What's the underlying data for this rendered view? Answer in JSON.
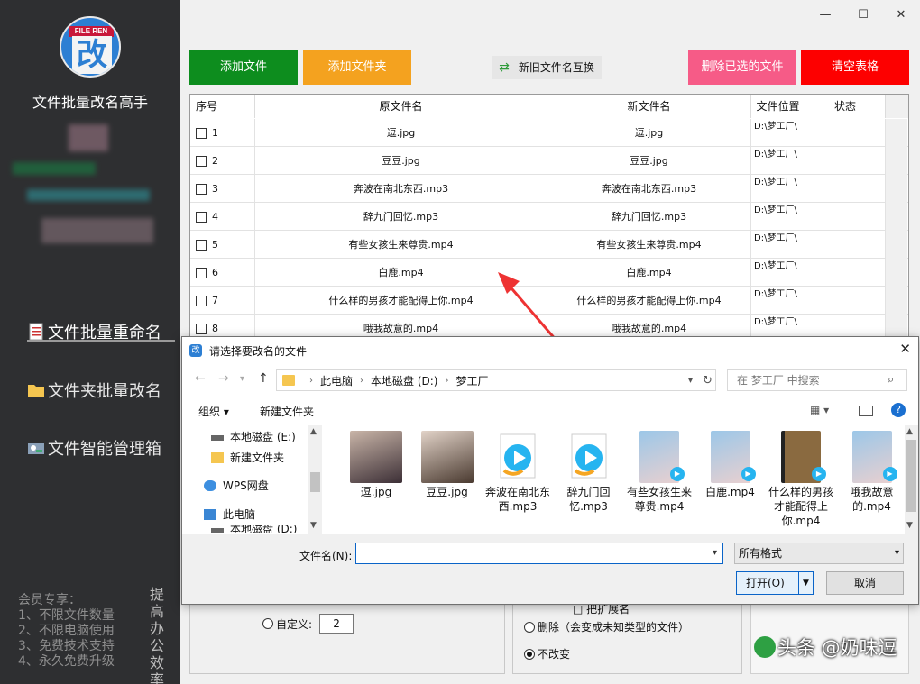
{
  "sidebar": {
    "logo_tag": "FILE REN",
    "logo_glyph": "改",
    "app_title": "文件批量改名高手",
    "nav": [
      "文件批量重命名",
      "文件夹批量改名",
      "文件智能管理箱"
    ],
    "member_lines": [
      "会员专享：",
      "1、不限文件数量",
      "2、不限电脑使用",
      "3、免费技术支持",
      "4、永久免费升级"
    ],
    "vertical_slogan": [
      "提",
      "高",
      "办",
      "公",
      "效",
      "率"
    ]
  },
  "window_controls": {
    "minimize": "—",
    "maximize": "☐",
    "close": "✕"
  },
  "toolbar": {
    "add_file": "添加文件",
    "add_folder": "添加文件夹",
    "swap_names": "新旧文件名互换",
    "delete_selected": "删除已选的文件",
    "clear_table": "清空表格"
  },
  "table": {
    "headers": [
      "序号",
      "原文件名",
      "新文件名",
      "文件位置",
      "状态"
    ],
    "rows": [
      {
        "index": "1",
        "original": "逗.jpg",
        "new": "逗.jpg",
        "location": "D:\\梦工厂\\",
        "status": ""
      },
      {
        "index": "2",
        "original": "豆豆.jpg",
        "new": "豆豆.jpg",
        "location": "D:\\梦工厂\\",
        "status": ""
      },
      {
        "index": "3",
        "original": "奔波在南北东西.mp3",
        "new": "奔波在南北东西.mp3",
        "location": "D:\\梦工厂\\",
        "status": ""
      },
      {
        "index": "4",
        "original": "辞九门回忆.mp3",
        "new": "辞九门回忆.mp3",
        "location": "D:\\梦工厂\\",
        "status": ""
      },
      {
        "index": "5",
        "original": "有些女孩生来尊贵.mp4",
        "new": "有些女孩生来尊贵.mp4",
        "location": "D:\\梦工厂\\",
        "status": ""
      },
      {
        "index": "6",
        "original": "白鹿.mp4",
        "new": "白鹿.mp4",
        "location": "D:\\梦工厂\\",
        "status": ""
      },
      {
        "index": "7",
        "original": "什么样的男孩才能配得上你.mp4",
        "new": "什么样的男孩才能配得上你.mp4",
        "location": "D:\\梦工厂\\",
        "status": ""
      },
      {
        "index": "8",
        "original": "哦我故意的.mp4",
        "new": "哦我故意的.mp4",
        "location": "D:\\梦工厂\\",
        "status": ""
      }
    ]
  },
  "options": {
    "custom_label": "自定义:",
    "custom_value": "2",
    "partial_top_text": "□ 把扩展名",
    "delete_ext_label": "删除（会变成未知类型的文件）",
    "no_change_label": "不改变"
  },
  "watermark": "头条 @奶味逗",
  "dialog": {
    "title": "请选择要改名的文件",
    "close": "✕",
    "breadcrumb": [
      "此电脑",
      "本地磁盘 (D:)",
      "梦工厂"
    ],
    "search_placeholder": "在 梦工厂 中搜索",
    "organize": "组织 ▾",
    "new_folder": "新建文件夹",
    "tree": [
      "本地磁盘 (E:)",
      "新建文件夹",
      "WPS网盘",
      "此电脑"
    ],
    "tree_partial": "本地磁盘 (D:)",
    "files": [
      {
        "name": "逗.jpg",
        "kind": "photo"
      },
      {
        "name": "豆豆.jpg",
        "kind": "photo"
      },
      {
        "name": "奔波在南北东西.mp3",
        "kind": "audio"
      },
      {
        "name": "辞九门回忆.mp3",
        "kind": "audio"
      },
      {
        "name": "有些女孩生来尊贵.mp4",
        "kind": "video"
      },
      {
        "name": "白鹿.mp4",
        "kind": "video"
      },
      {
        "name": "什么样的男孩才能配得上你.mp4",
        "kind": "video-film"
      },
      {
        "name": "哦我故意的.mp4",
        "kind": "video"
      }
    ],
    "filename_label": "文件名(N):",
    "filename_value": "",
    "filter": "所有格式",
    "open_button": "打开(O)",
    "cancel_button": "取消"
  },
  "colors": {
    "add_file": "#0d8d1e",
    "add_folder": "#f4a21f",
    "delete_selected": "#f65b87",
    "clear_table": "#fd0000",
    "sidebar": "#2e2f31",
    "annotation_arrow": "#ee3333"
  }
}
